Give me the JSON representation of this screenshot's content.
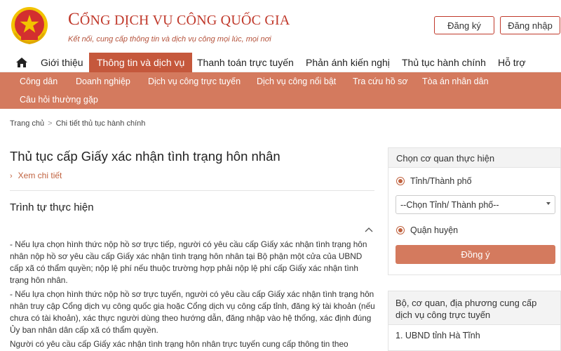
{
  "header": {
    "title_first_letter": "C",
    "title_rest": "ỔNG DỊCH VỤ CÔNG QUỐC GIA",
    "slogan": "Kết nối, cung cấp thông tin và dịch vụ công mọi lúc, mọi nơi",
    "register_label": "Đăng ký",
    "login_label": "Đăng nhập"
  },
  "main_nav": {
    "items": [
      {
        "label": "Giới thiệu"
      },
      {
        "label": "Thông tin và dịch vụ"
      },
      {
        "label": "Thanh toán trực tuyến"
      },
      {
        "label": "Phản ánh kiến nghị"
      },
      {
        "label": "Thủ tục hành chính"
      },
      {
        "label": "Hỗ trợ"
      }
    ]
  },
  "sub_nav": {
    "items": [
      {
        "label": "Công dân"
      },
      {
        "label": "Doanh nghiệp"
      },
      {
        "label": "Dịch vụ công trực tuyến"
      },
      {
        "label": "Dịch vụ công nổi bật"
      },
      {
        "label": "Tra cứu hồ sơ"
      },
      {
        "label": "Tòa án nhân dân"
      },
      {
        "label": "Câu hỏi thường gặp"
      }
    ]
  },
  "breadcrumb": {
    "home": "Trang chủ",
    "sep": ">",
    "current": "Chi tiết thủ tục hành chính"
  },
  "content": {
    "title": "Thủ tục cấp Giấy xác nhận tình trạng hôn nhân",
    "detail_link": "Xem chi tiết",
    "detail_chevron": "›",
    "section_title": "Trình tự thực hiện",
    "paragraphs": [
      "- Nếu lựa chọn hình thức nộp hồ sơ trực tiếp, người có yêu cầu cấp Giấy xác nhận tình trạng hôn nhân nộp hồ sơ yêu cầu cấp Giấy xác nhận tình trạng hôn nhân tại Bộ phận một cửa của UBND cấp xã có thẩm quyền; nộp lệ phí nếu thuộc trường hợp phải nộp lệ phí cấp Giấy xác nhận tình trạng hôn nhân.",
      "- Nếu lựa chọn hình thức nộp hồ sơ trực tuyến, người có yêu cầu cấp Giấy xác nhận tình trạng hôn nhân truy cập Cổng dịch vụ công quốc gia hoặc Cổng dịch vụ công cấp tỉnh, đăng ký tài khoản (nếu chưa có tài khoản), xác thực người dùng theo hướng dẫn, đăng nhập vào hệ thống, xác định đúng Ủy ban nhân dân cấp xã có thẩm quyền.",
      "Người có yêu cầu cấp Giấy xác nhận tình trạng hôn nhân trực tuyến cung cấp thông tin theo"
    ]
  },
  "sidebar": {
    "panel1": {
      "title": "Chọn cơ quan thực hiện",
      "option_province": "Tỉnh/Thành phố",
      "select_value": "--Chọn Tỉnh/ Thành phố--",
      "option_district": "Quận huyện",
      "agree_label": "Đồng ý"
    },
    "panel2": {
      "title": "Bộ, cơ quan, địa phương cung cấp dịch vụ công trực tuyến",
      "first_item": "1. UBND tỉnh Hà Tĩnh"
    }
  },
  "colors": {
    "brand_red": "#c0392b",
    "nav_active": "#c5583c",
    "subnav_bg": "#d47a5e",
    "emblem_red": "#d32f2f",
    "emblem_gold": "#f2c300"
  }
}
